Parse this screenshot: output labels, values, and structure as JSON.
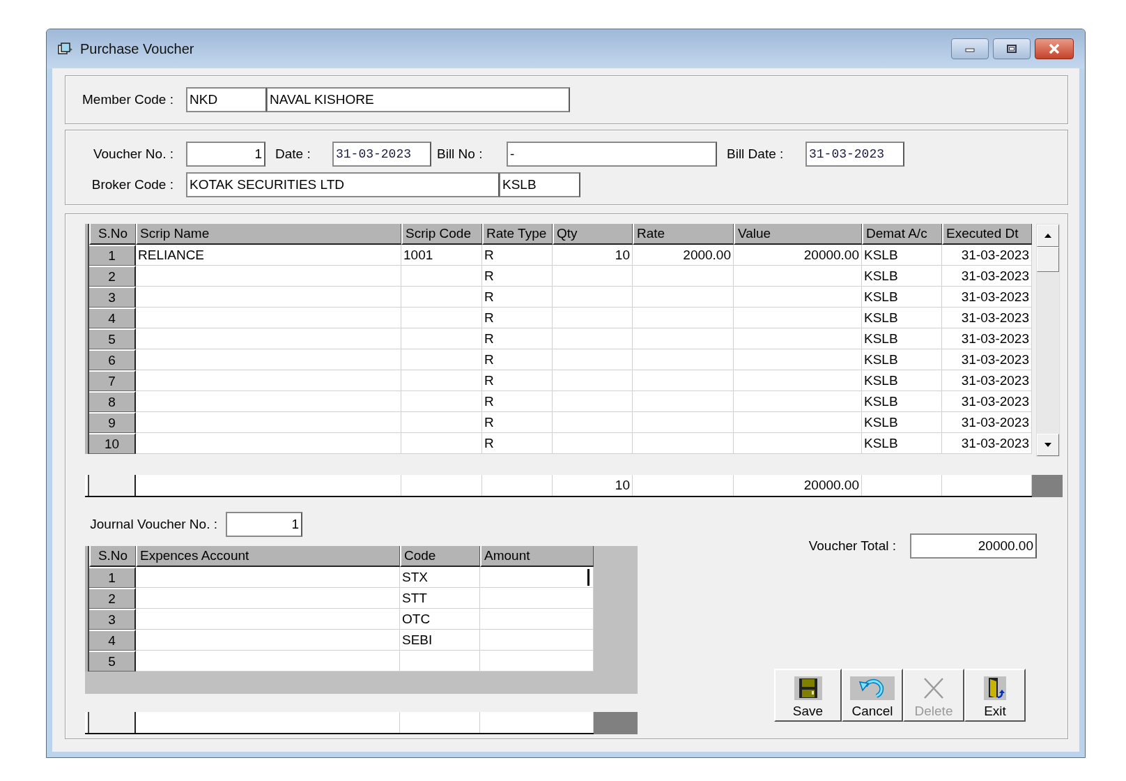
{
  "window": {
    "title": "Purchase Voucher"
  },
  "member": {
    "label": "Member Code :",
    "code": "NKD",
    "name": "NAVAL KISHORE"
  },
  "voucher": {
    "voucher_no_label": "Voucher No. :",
    "voucher_no": "1",
    "date_label": "Date :",
    "date": "31-03-2023",
    "bill_no_label": "Bill No :",
    "bill_no": "-",
    "bill_date_label": "Bill Date :",
    "bill_date": "31-03-2023",
    "broker_label": "Broker Code :",
    "broker_name": "KOTAK SECURITIES LTD",
    "broker_code": "KSLB"
  },
  "trades": {
    "columns": [
      "S.No",
      "Scrip Name",
      "Scrip Code",
      "Rate Type",
      "Qty",
      "Rate",
      "Value",
      "Demat A/c",
      "Executed Dt"
    ],
    "rows": [
      {
        "sno": "1",
        "scrip_name": "RELIANCE",
        "scrip_code": "1001",
        "rate_type": "R",
        "qty": "10",
        "rate": "2000.00",
        "value": "20000.00",
        "demat": "KSLB",
        "executed": "31-03-2023"
      },
      {
        "sno": "2",
        "rate_type": "R",
        "demat": "KSLB",
        "executed": "31-03-2023"
      },
      {
        "sno": "3",
        "rate_type": "R",
        "demat": "KSLB",
        "executed": "31-03-2023"
      },
      {
        "sno": "4",
        "rate_type": "R",
        "demat": "KSLB",
        "executed": "31-03-2023"
      },
      {
        "sno": "5",
        "rate_type": "R",
        "demat": "KSLB",
        "executed": "31-03-2023"
      },
      {
        "sno": "6",
        "rate_type": "R",
        "demat": "KSLB",
        "executed": "31-03-2023"
      },
      {
        "sno": "7",
        "rate_type": "R",
        "demat": "KSLB",
        "executed": "31-03-2023"
      },
      {
        "sno": "8",
        "rate_type": "R",
        "demat": "KSLB",
        "executed": "31-03-2023"
      },
      {
        "sno": "9",
        "rate_type": "R",
        "demat": "KSLB",
        "executed": "31-03-2023"
      },
      {
        "sno": "10",
        "rate_type": "R",
        "demat": "KSLB",
        "executed": "31-03-2023"
      }
    ],
    "totals": {
      "qty": "10",
      "value": "20000.00"
    }
  },
  "journal": {
    "label": "Journal Voucher No. :",
    "value": "1"
  },
  "expenses": {
    "columns": [
      "S.No",
      "Expences Account",
      "Code",
      "Amount"
    ],
    "rows": [
      {
        "sno": "1",
        "code": "STX",
        "focused": true
      },
      {
        "sno": "2",
        "code": "STT",
        "focused": false
      },
      {
        "sno": "3",
        "code": "OTC",
        "focused": false
      },
      {
        "sno": "4",
        "code": "SEBI",
        "focused": false
      },
      {
        "sno": "5",
        "focused": false
      }
    ]
  },
  "voucher_total": {
    "label": "Voucher Total :",
    "value": "20000.00"
  },
  "buttons": [
    {
      "kind": "save",
      "label": "Save",
      "disabled": false
    },
    {
      "kind": "cancel",
      "label": "Cancel",
      "disabled": false
    },
    {
      "kind": "delete",
      "label": "Delete",
      "disabled": true
    },
    {
      "kind": "exit",
      "label": "Exit",
      "disabled": false
    }
  ]
}
